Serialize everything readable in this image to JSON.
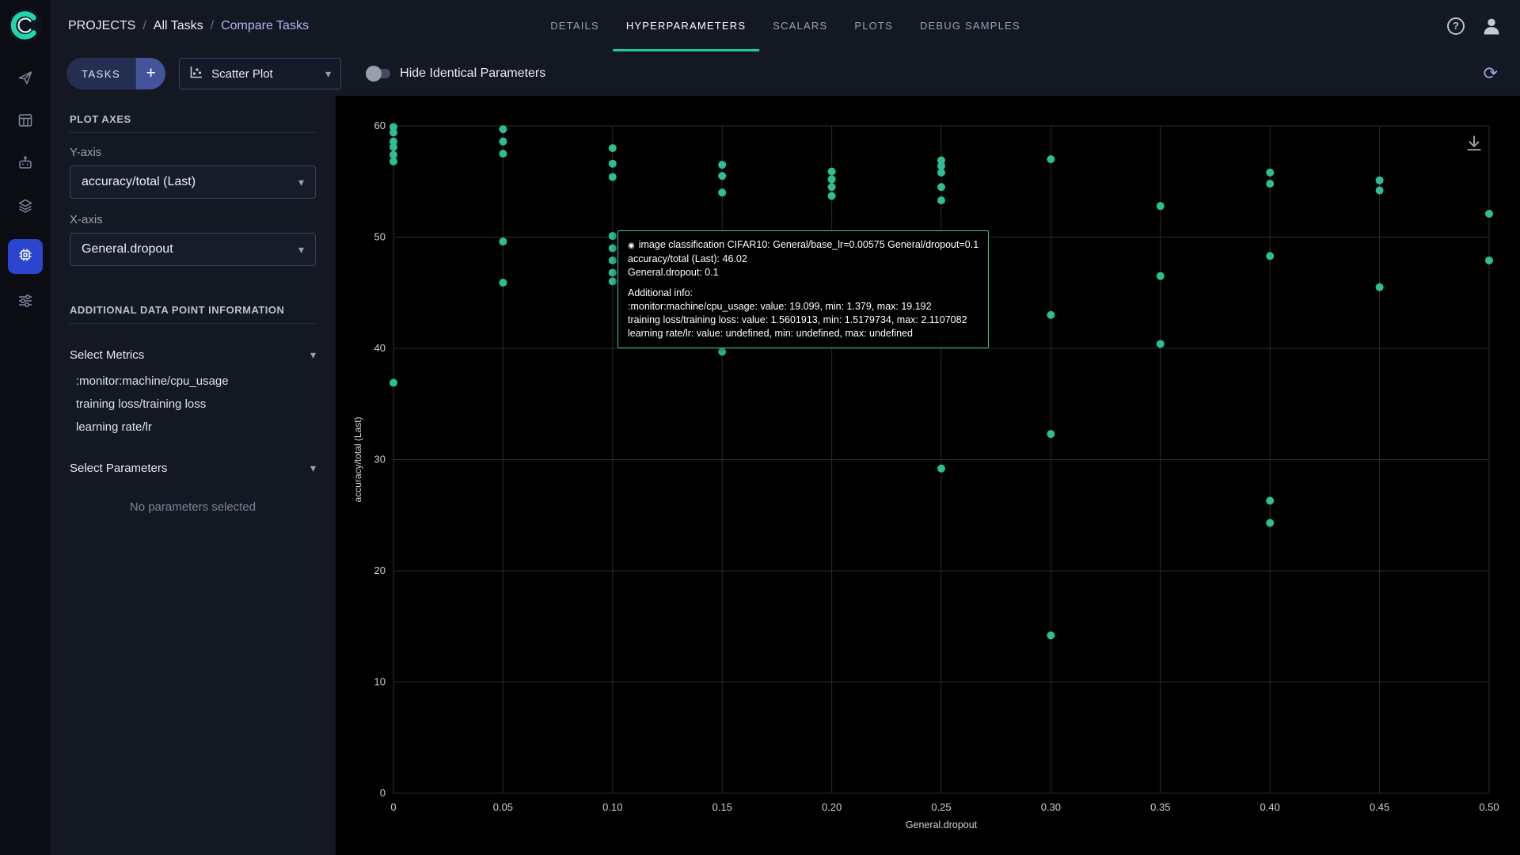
{
  "brand": {
    "accent": "#1ec9a6",
    "active_nav_bg": "#2a46cf"
  },
  "header": {
    "breadcrumb": [
      {
        "label": "PROJECTS"
      },
      {
        "label": "All Tasks"
      },
      {
        "label": "Compare Tasks"
      }
    ],
    "separator": "/",
    "tabs": [
      {
        "label": "DETAILS",
        "active": false
      },
      {
        "label": "HYPERPARAMETERS",
        "active": true
      },
      {
        "label": "SCALARS",
        "active": false
      },
      {
        "label": "PLOTS",
        "active": false
      },
      {
        "label": "DEBUG SAMPLES",
        "active": false
      }
    ]
  },
  "toolbar": {
    "tasks_button": "TASKS",
    "view_selector": "Scatter Plot",
    "hide_identical_label": "Hide Identical Parameters",
    "toggle_state": "off"
  },
  "panel": {
    "plot_axes_title": "PLOT AXES",
    "y_axis_label": "Y-axis",
    "y_axis_value": "accuracy/total (Last)",
    "x_axis_label": "X-axis",
    "x_axis_value": "General.dropout",
    "additional_info_title": "ADDITIONAL DATA POINT INFORMATION",
    "select_metrics_label": "Select Metrics",
    "metrics": [
      ":monitor:machine/cpu_usage",
      "training loss/training loss",
      "learning rate/lr"
    ],
    "select_parameters_label": "Select Parameters",
    "no_parameters_text": "No parameters selected"
  },
  "icons": {
    "plus": "+",
    "help": "?",
    "caret": "▾",
    "refresh": "⟳",
    "tooltip_marker": "◉"
  },
  "tooltip": {
    "title": "image classification CIFAR10: General/base_lr=0.00575 General/dropout=0.1",
    "metric_line": "accuracy/total (Last): 46.02",
    "param_line": "General.dropout: 0.1",
    "additional_header": "Additional info:",
    "additional_lines": [
      ":monitor:machine/cpu_usage: value: 19.099, min: 1.379, max: 19.192",
      "training loss/training loss: value: 1.5601913, min: 1.5179734, max: 2.1107082",
      "learning rate/lr: value: undefined, min: undefined, max: undefined"
    ]
  },
  "chart_data": {
    "type": "scatter",
    "title": "",
    "xlabel": "General.dropout",
    "ylabel": "accuracy/total (Last)",
    "xlim": [
      0,
      0.5
    ],
    "ylim": [
      0,
      60
    ],
    "xticks": [
      0,
      0.05,
      0.1,
      0.15,
      0.2,
      0.25,
      0.3,
      0.35,
      0.4,
      0.45,
      0.5
    ],
    "yticks": [
      0,
      10,
      20,
      30,
      40,
      50,
      60
    ],
    "grid": true,
    "legend": false,
    "point_color": "#2dbe95",
    "grid_color": "#262c34",
    "tick_color": "#ccd1d8",
    "points": [
      [
        0,
        59.9
      ],
      [
        0,
        59.4
      ],
      [
        0,
        58.6
      ],
      [
        0,
        58.1
      ],
      [
        0,
        57.4
      ],
      [
        0,
        56.8
      ],
      [
        0,
        36.9
      ],
      [
        0.05,
        59.7
      ],
      [
        0.05,
        58.6
      ],
      [
        0.05,
        57.5
      ],
      [
        0.05,
        49.6
      ],
      [
        0.05,
        45.9
      ],
      [
        0.1,
        58.0
      ],
      [
        0.1,
        56.6
      ],
      [
        0.1,
        55.4
      ],
      [
        0.1,
        50.1
      ],
      [
        0.1,
        49.0
      ],
      [
        0.1,
        47.9
      ],
      [
        0.1,
        46.8
      ],
      [
        0.1,
        46.02
      ],
      [
        0.15,
        56.5
      ],
      [
        0.15,
        55.5
      ],
      [
        0.15,
        54.0
      ],
      [
        0.15,
        39.7
      ],
      [
        0.2,
        55.9
      ],
      [
        0.2,
        55.2
      ],
      [
        0.2,
        54.5
      ],
      [
        0.2,
        53.7
      ],
      [
        0.25,
        56.9
      ],
      [
        0.25,
        56.4
      ],
      [
        0.25,
        55.8
      ],
      [
        0.25,
        54.5
      ],
      [
        0.25,
        53.3
      ],
      [
        0.25,
        40.9
      ],
      [
        0.25,
        29.2
      ],
      [
        0.3,
        57.0
      ],
      [
        0.3,
        43.0
      ],
      [
        0.3,
        32.3
      ],
      [
        0.3,
        14.2
      ],
      [
        0.35,
        52.8
      ],
      [
        0.35,
        46.5
      ],
      [
        0.35,
        40.4
      ],
      [
        0.4,
        55.8
      ],
      [
        0.4,
        54.8
      ],
      [
        0.4,
        48.3
      ],
      [
        0.4,
        26.3
      ],
      [
        0.4,
        24.3
      ],
      [
        0.45,
        55.1
      ],
      [
        0.45,
        54.2
      ],
      [
        0.45,
        45.5
      ],
      [
        0.5,
        52.1
      ],
      [
        0.5,
        47.9
      ]
    ],
    "highlighted_point": {
      "x": 0.1,
      "y": 46.02
    }
  }
}
